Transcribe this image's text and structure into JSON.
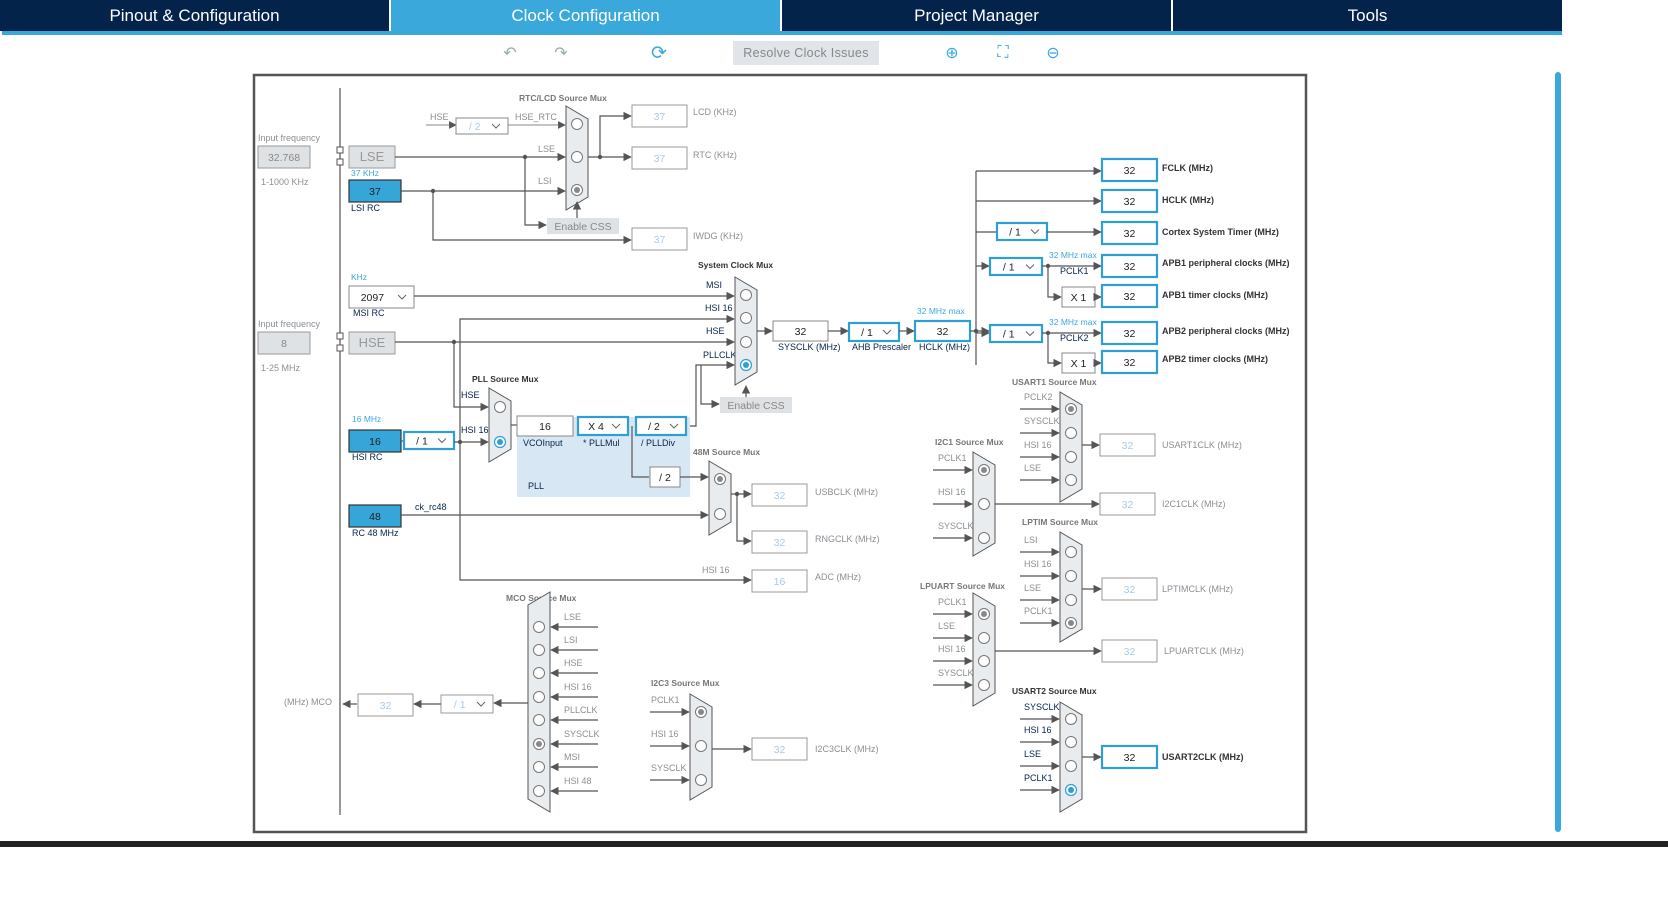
{
  "tabs": [
    "Pinout & Configuration",
    "Clock Configuration",
    "Project Manager",
    "Tools"
  ],
  "active_tab": "Clock Configuration",
  "toolbar": {
    "resolve": "Resolve Clock Issues",
    "undo": "↶",
    "redo": "↷",
    "refresh": "⟳",
    "zoom_in": "⊕",
    "fit": "⛶",
    "zoom_out": "⊖"
  },
  "colors": {
    "accent": "#3ba8dc",
    "nav": "#03234b"
  },
  "lse": {
    "input_label": "Input frequency",
    "input_value": "32.768",
    "range": "1-1000 KHz",
    "name": "LSE"
  },
  "lsi": {
    "freq": "37 KHz",
    "value": "37",
    "name": "LSI RC"
  },
  "rtc": {
    "title": "RTC/LCD Source Mux",
    "hse": "HSE",
    "div": "/ 2",
    "hse_rtc": "HSE_RTC",
    "lse": "LSE",
    "lsi": "LSI",
    "css": "Enable CSS",
    "lcd_value": "37",
    "lcd_label": "LCD (KHz)",
    "rtc_value": "37",
    "rtc_label": "RTC (KHz)",
    "iwdg_value": "37",
    "iwdg_label": "IWDG (KHz)"
  },
  "msi": {
    "unit": "KHz",
    "value": "2097",
    "name": "MSI RC"
  },
  "hse": {
    "input_label": "Input frequency",
    "input_value": "8",
    "range": "1-25 MHz",
    "name": "HSE"
  },
  "sys": {
    "title": "System Clock Mux",
    "msi": "MSI",
    "hsi": "HSI 16",
    "hse": "HSE",
    "pll": "PLLCLK",
    "css": "Enable CSS",
    "sysclk_value": "32",
    "sysclk_label": "SYSCLK (MHz)",
    "ahb": "/ 1",
    "ahb_label": "AHB Prescaler",
    "hclk_max": "32 MHz max",
    "hclk_value": "32",
    "hclk_label": "HCLK (MHz)"
  },
  "outputs": {
    "fclk": {
      "value": "32",
      "label": "FCLK (MHz)"
    },
    "hclk": {
      "value": "32",
      "label": "HCLK (MHz)"
    },
    "cortex": {
      "div": "/ 1",
      "value": "32",
      "label": "Cortex System Timer (MHz)"
    },
    "apb1": {
      "div": "/ 1",
      "max": "32 MHz max",
      "pclk": "PCLK1",
      "value": "32",
      "label": "APB1 peripheral clocks (MHz)",
      "mul": "X 1",
      "timer_value": "32",
      "timer_label": "APB1 timer clocks (MHz)"
    },
    "apb2": {
      "div": "/ 1",
      "max": "32 MHz max",
      "pclk": "PCLK2",
      "value": "32",
      "label": "APB2 peripheral clocks (MHz)",
      "mul": "X 1",
      "timer_value": "32",
      "timer_label": "APB2 timer clocks (MHz)"
    }
  },
  "hsi": {
    "freq": "16 MHz",
    "value": "16",
    "name": "HSI RC",
    "div": "/ 1"
  },
  "pll": {
    "title": "PLL Source Mux",
    "hse": "HSE",
    "hsi": "HSI 16",
    "vco_value": "16",
    "vco_label": "VCOInput",
    "mul": "X 4",
    "mul_label": "* PLLMul",
    "div": "/ 2",
    "div_label": "/ PLLDiv",
    "div2": "/ 2",
    "name": "PLL"
  },
  "m48": {
    "title": "48M Source Mux",
    "usb_value": "32",
    "usb_label": "USBCLK (MHz)",
    "rng_value": "32",
    "rng_label": "RNGCLK (MHz)",
    "adc_hsi": "HSI 16",
    "adc_value": "16",
    "adc_label": "ADC (MHz)"
  },
  "rc48": {
    "value": "48",
    "name": "RC 48 MHz",
    "signal": "ck_rc48"
  },
  "mco": {
    "title": "MCO Source Mux",
    "inputs": [
      "LSE",
      "LSI",
      "HSE",
      "HSI 16",
      "PLLCLK",
      "SYSCLK",
      "MSI",
      "HSI 48"
    ],
    "div": "/ 1",
    "value": "32",
    "label": "(MHz) MCO"
  },
  "i2c3": {
    "title": "I2C3 Source Mux",
    "inputs": [
      "PCLK1",
      "HSI 16",
      "SYSCLK"
    ],
    "value": "32",
    "label": "I2C3CLK (MHz)"
  },
  "i2c1": {
    "title": "I2C1 Source Mux",
    "inputs": [
      "PCLK1",
      "HSI 16",
      "SYSCLK"
    ],
    "value": "32",
    "label": "I2C1CLK (MHz)"
  },
  "usart1": {
    "title": "USART1 Source Mux",
    "inputs": [
      "PCLK2",
      "SYSCLK",
      "HSI 16",
      "LSE"
    ],
    "value": "32",
    "label": "USART1CLK (MHz)"
  },
  "lptim": {
    "title": "LPTIM Source Mux",
    "inputs": [
      "LSI",
      "HSI 16",
      "LSE",
      "PCLK1"
    ],
    "value": "32",
    "label": "LPTIMCLK (MHz)"
  },
  "lpuart": {
    "title": "LPUART Source Mux",
    "inputs": [
      "PCLK1",
      "LSE",
      "HSI 16",
      "SYSCLK"
    ],
    "value": "32",
    "label": "LPUARTCLK (MHz)"
  },
  "usart2": {
    "title": "USART2 Source Mux",
    "inputs": [
      "SYSCLK",
      "HSI 16",
      "LSE",
      "PCLK1"
    ],
    "value": "32",
    "label": "USART2CLK (MHz)"
  }
}
